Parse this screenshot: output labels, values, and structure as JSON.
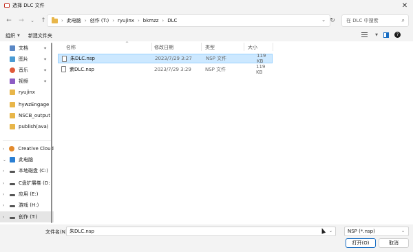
{
  "window": {
    "title": "选择 DLC 文件"
  },
  "breadcrumb": [
    "此电脑",
    "创作 (T:)",
    "ryujinx",
    "bkmzz",
    "DLC"
  ],
  "search": {
    "placeholder": "在 DLC 中搜索"
  },
  "toolbar": {
    "organize": "组织",
    "new_folder": "新建文件夹"
  },
  "sidebar": {
    "items": [
      {
        "label": "文档",
        "icon": "document-icon",
        "pinned": true
      },
      {
        "label": "图片",
        "icon": "pictures-icon",
        "pinned": true
      },
      {
        "label": "音乐",
        "icon": "music-icon",
        "pinned": true
      },
      {
        "label": "视频",
        "icon": "videos-icon",
        "pinned": true
      },
      {
        "label": "ryujinx",
        "icon": "folder-icon"
      },
      {
        "label": "hywzEngage",
        "icon": "folder-icon"
      },
      {
        "label": "NSCB_output",
        "icon": "folder-icon"
      },
      {
        "label": "publish(ava)",
        "icon": "folder-icon"
      },
      {
        "label": "Creative Cloud",
        "icon": "creative-cloud-icon"
      },
      {
        "label": "此电脑",
        "icon": "this-pc-icon"
      },
      {
        "label": "本地磁盘 (C:)",
        "icon": "drive-icon"
      },
      {
        "label": "C盘扩展卷 (D:",
        "icon": "drive-icon"
      },
      {
        "label": "应用 (E:)",
        "icon": "drive-icon"
      },
      {
        "label": "游戏 (H:)",
        "icon": "drive-icon"
      },
      {
        "label": "创作 (T:)",
        "icon": "drive-icon",
        "selected": true
      }
    ]
  },
  "columns": {
    "name": "名称",
    "date": "修改日期",
    "type": "类型",
    "size": "大小"
  },
  "files": [
    {
      "name": "朱DLC.nsp",
      "date": "2023/7/29 3:27",
      "type": "NSP 文件",
      "size": "119 KB",
      "selected": true
    },
    {
      "name": "紫DLC.nsp",
      "date": "2023/7/29 3:29",
      "type": "NSP 文件",
      "size": "119 KB",
      "selected": false
    }
  ],
  "footer": {
    "filename_label": "文件名(N):",
    "filename_value": "朱DLC.nsp",
    "filetype_value": "NSP (*.nsp)",
    "open_label": "打开(O)",
    "cancel_label": "取消"
  },
  "colors": {
    "accent": "#1a6fc4",
    "selection": "#cce8ff",
    "chrome": "#f3f3f3"
  }
}
